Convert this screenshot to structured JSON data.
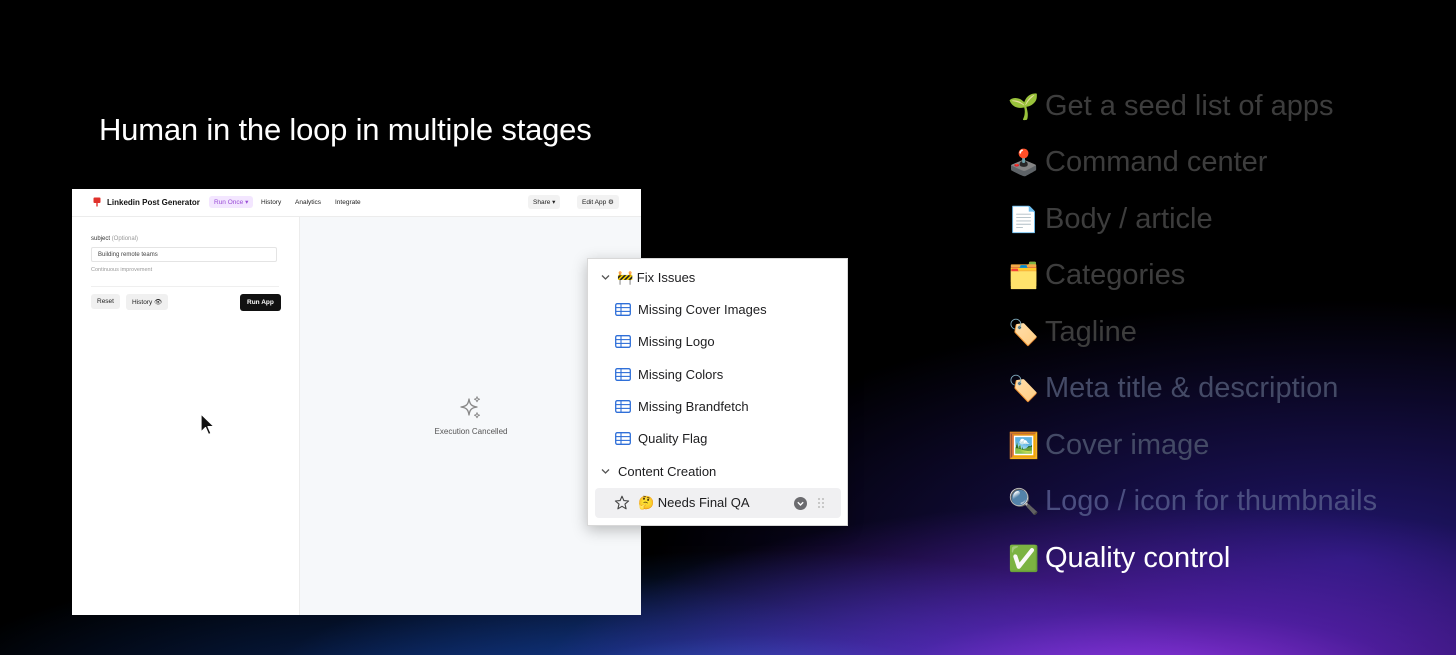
{
  "slide": {
    "title": "Human in the loop in multiple stages"
  },
  "app": {
    "name": "Linkedin Post Generator",
    "nav": {
      "run_once": "Run Once ▾",
      "history": "History",
      "analytics": "Analytics",
      "integrate": "Integrate",
      "share": "Share ▾",
      "edit_app": "Edit App ⚙"
    },
    "form": {
      "field_label": "subject",
      "field_optional": "(Optional)",
      "field_value": "Building remote teams",
      "field_hint": "Continuous improvement",
      "reset": "Reset",
      "history": "History 👁",
      "run": "Run App"
    },
    "output": {
      "status": "Execution Cancelled"
    },
    "icons": {
      "logo": "pin-icon",
      "sparkle": "sparkles-icon",
      "cursor": "mouse-pointer-icon"
    }
  },
  "popup": {
    "groups": [
      {
        "label": "🚧 Fix Issues",
        "items": [
          {
            "label": "Missing Cover Images"
          },
          {
            "label": "Missing Logo"
          },
          {
            "label": "Missing Colors"
          },
          {
            "label": "Missing Brandfetch"
          },
          {
            "label": "Quality Flag"
          }
        ]
      },
      {
        "label": "Content Creation",
        "items": [
          {
            "label": "🤔 Needs Final QA"
          }
        ]
      }
    ],
    "accent_color": "#2f6fd8"
  },
  "steps": [
    {
      "emoji": "🌱",
      "label": "Get a seed list of apps"
    },
    {
      "emoji": "🕹️",
      "label": "Command center"
    },
    {
      "emoji": "📄",
      "label": "Body / article"
    },
    {
      "emoji": "🗂️",
      "label": "Categories"
    },
    {
      "emoji": "🏷️",
      "label": "Tagline"
    },
    {
      "emoji": "🏷️",
      "label": "Meta title & description"
    },
    {
      "emoji": "🖼️",
      "label": "Cover image"
    },
    {
      "emoji": "🔍",
      "label": "Logo / icon for thumbnails"
    },
    {
      "emoji": "✅",
      "label": "Quality control"
    }
  ],
  "active_step": "Quality control"
}
